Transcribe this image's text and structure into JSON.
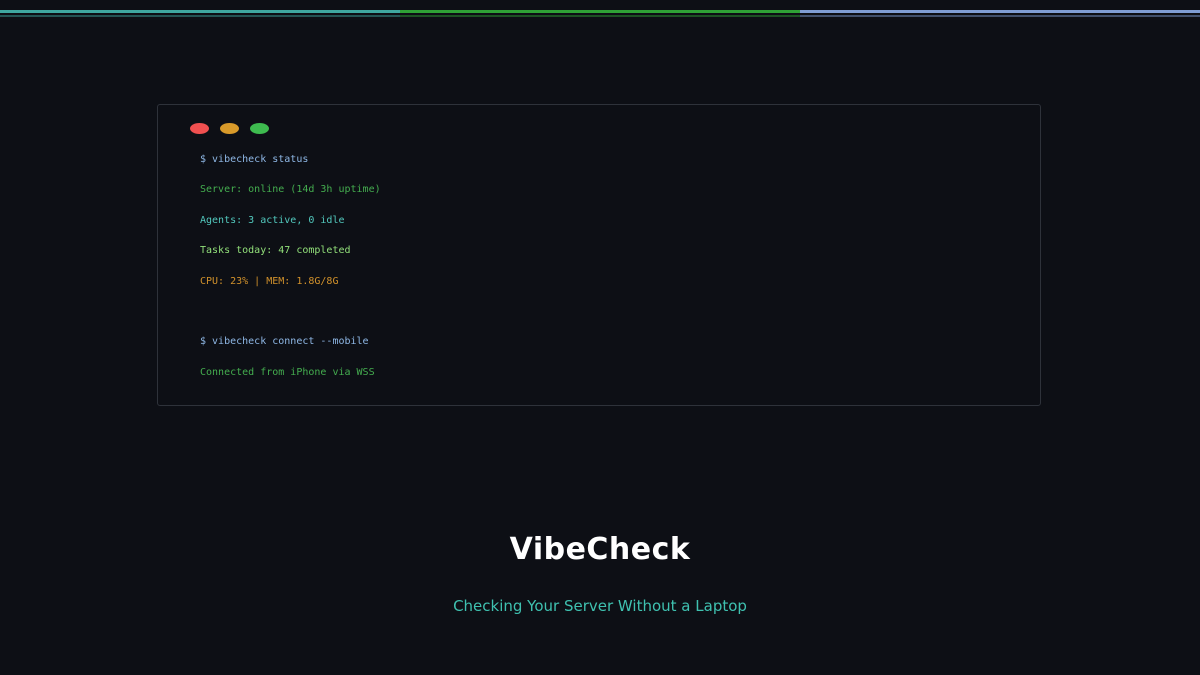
{
  "colors": {
    "background": "#0d0f15",
    "stripe": [
      "#3fa7a0",
      "#2fa236",
      "#7f9dd4"
    ],
    "dot_red": "#f05050",
    "dot_yellow": "#d89a2a",
    "dot_green": "#3ebb4f",
    "prompt": "#8fb8e6",
    "ok_green": "#44ad4f",
    "teal": "#52c8bd",
    "bright_green": "#92e07a",
    "orange": "#d1912b",
    "subtitle": "#3fc1b0"
  },
  "terminal": {
    "window_controls": [
      "close-dot",
      "minimize-dot",
      "maximize-dot"
    ],
    "lines": [
      {
        "text": "$ vibecheck status",
        "color": "#8fb8e6"
      },
      {
        "text": "Server: online (14d 3h uptime)",
        "color": "#44ad4f"
      },
      {
        "text": "Agents: 3 active, 0 idle",
        "color": "#52c8bd"
      },
      {
        "text": "Tasks today: 47 completed",
        "color": "#92e07a"
      },
      {
        "text": "CPU: 23% | MEM: 1.8G/8G",
        "color": "#d1912b"
      },
      {
        "text": "$ vibecheck connect --mobile",
        "color": "#8fb8e6"
      },
      {
        "text": "Connected from iPhone via WSS",
        "color": "#44ad4f"
      }
    ]
  },
  "title": "VibeCheck",
  "subtitle": "Checking Your Server Without a Laptop"
}
